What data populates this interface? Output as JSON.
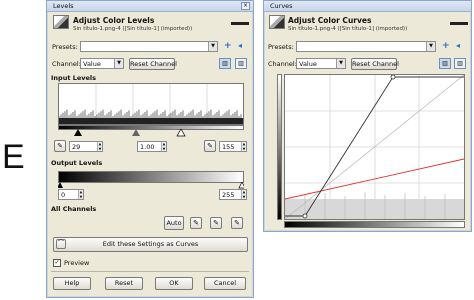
{
  "side_letter": "E",
  "levels": {
    "window_title": "Levels",
    "header_title": "Adjust Color Levels",
    "header_subtitle": "Sin título-1.png-4 ([Sin título-1] (imported))",
    "presets_label": "Presets:",
    "channel_label": "Channel:",
    "channel_value": "Value",
    "reset_channel_label": "Reset Channel",
    "input_levels_label": "Input Levels",
    "input_low": "29",
    "input_gamma": "1.00",
    "input_high": "155",
    "output_levels_label": "Output Levels",
    "output_low": "0",
    "output_high": "255",
    "all_channels_label": "All Channels",
    "auto_label": "Auto",
    "edit_curves_label": "Edit these Settings as Curves",
    "preview_label": "Preview",
    "help_label": "Help",
    "reset_label": "Reset",
    "ok_label": "OK",
    "cancel_label": "Cancel"
  },
  "curves": {
    "window_title": "Curves",
    "header_title": "Adjust Color Curves",
    "header_subtitle": "Sin título-1.png-4 ([Sin título-1] (imported))",
    "presets_label": "Presets:",
    "channel_label": "Channel:",
    "channel_value": "Value",
    "reset_channel_label": "Reset Channel"
  },
  "icons": {
    "add": "plus-icon",
    "menu": "menu-arrow-icon",
    "linear": "linear-histogram-icon",
    "log": "log-histogram-icon",
    "picker": "eyedropper-icon"
  },
  "colors": {
    "accent_red": "#e03030",
    "window_bg": "#ece9d8",
    "title_blue": "#c5d5ea"
  }
}
